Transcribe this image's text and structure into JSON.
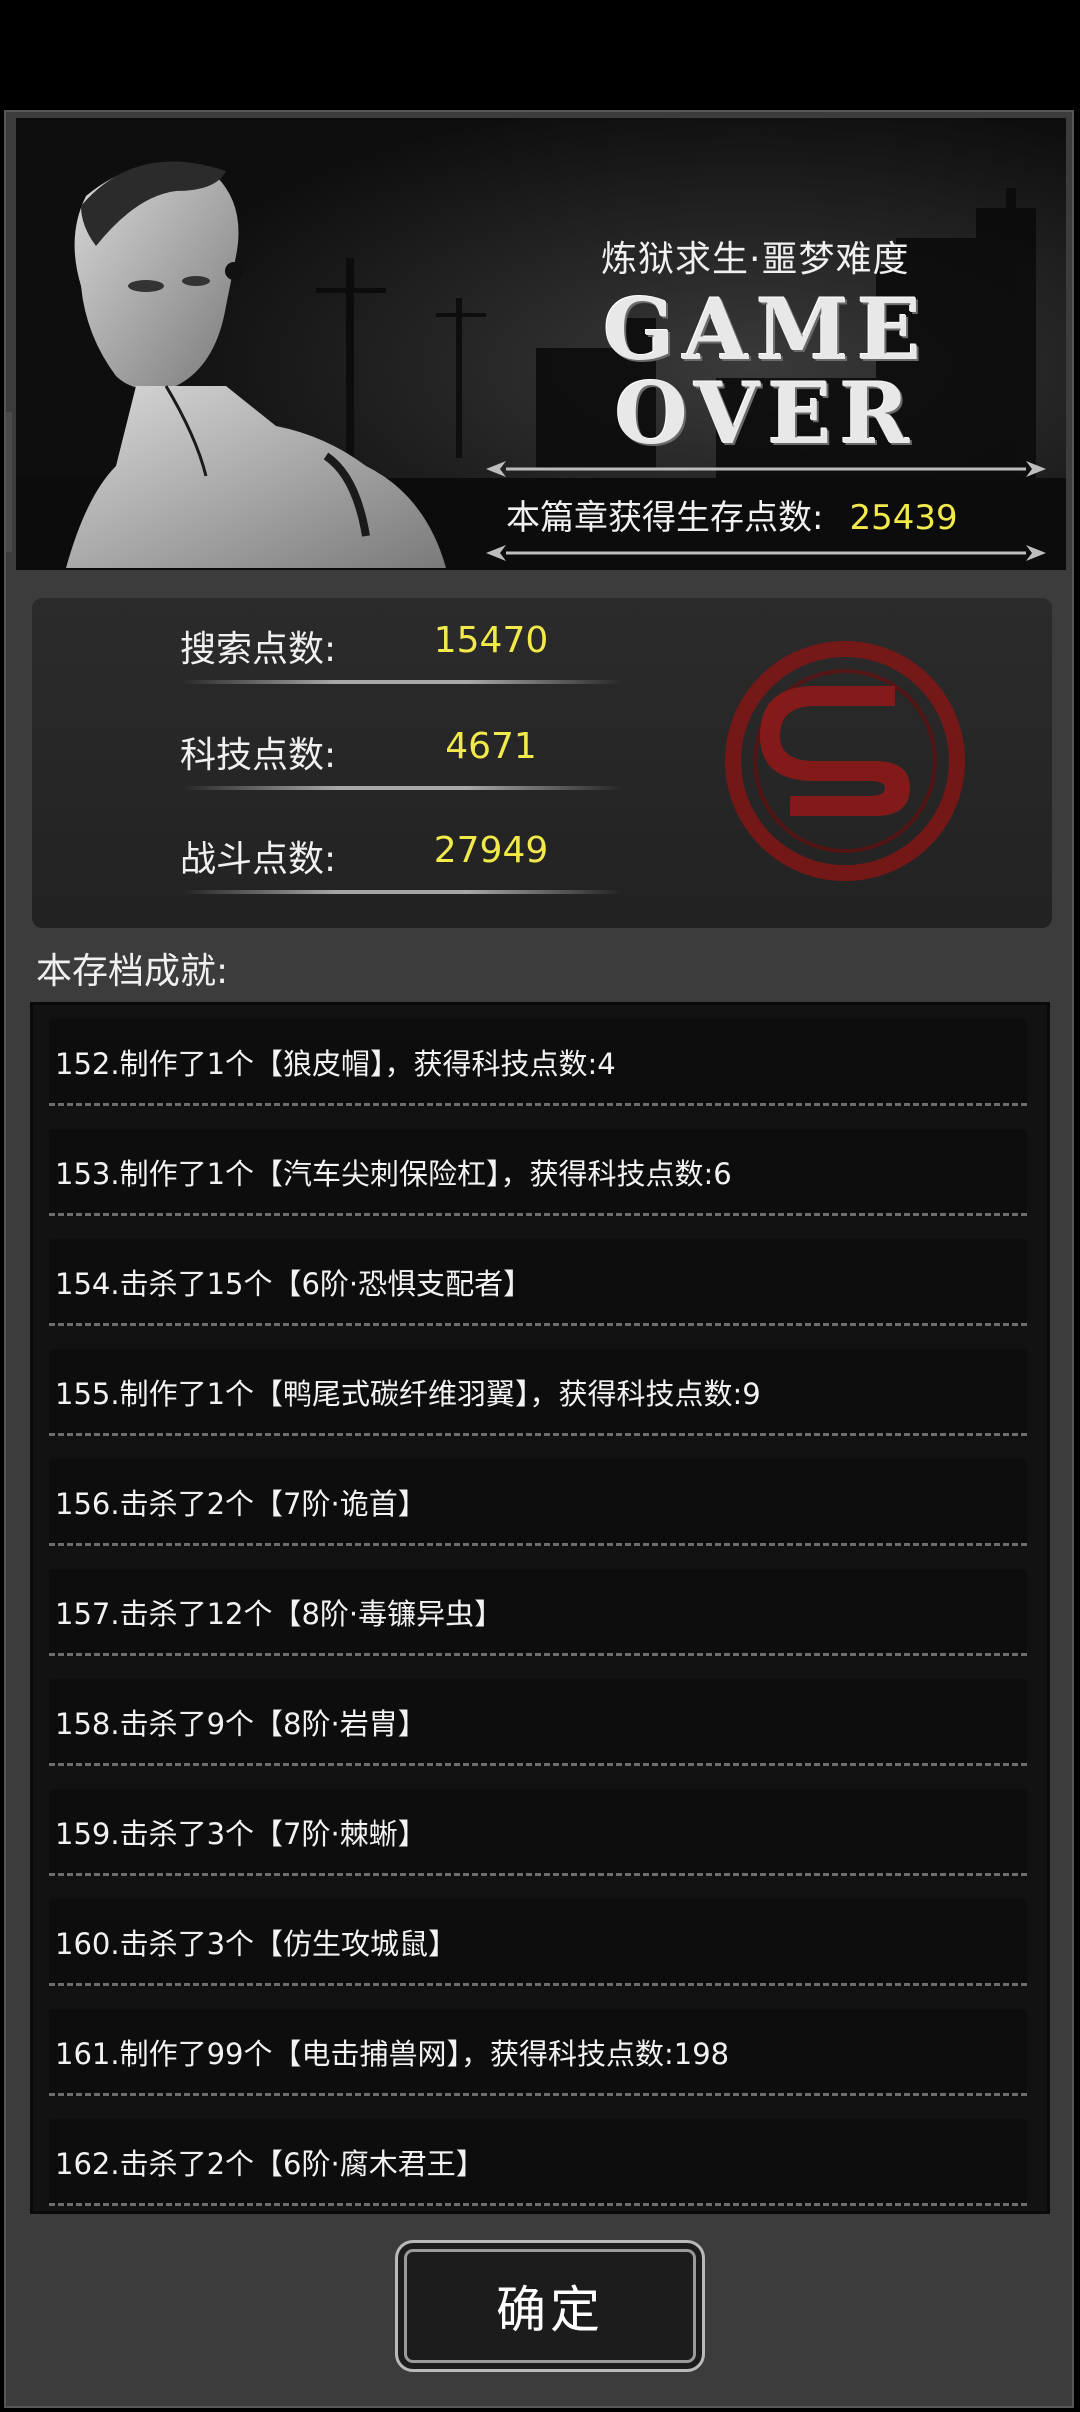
{
  "banner": {
    "subtitle": "炼狱求生·噩梦难度",
    "game_over_line1": "GAME",
    "game_over_line2": "OVER",
    "earned_label": "本篇章获得生存点数:",
    "earned_value": "25439"
  },
  "stats": [
    {
      "label": "搜索点数:",
      "value": "15470"
    },
    {
      "label": "科技点数:",
      "value": "4671"
    },
    {
      "label": "战斗点数:",
      "value": "27949"
    }
  ],
  "achievements_title": "本存档成就:",
  "achievements": [
    "152.制作了1个【狼皮帽】，获得科技点数:4",
    "153.制作了1个【汽车尖刺保险杠】，获得科技点数:6",
    "154.击杀了15个【6阶·恐惧支配者】",
    "155.制作了1个【鸭尾式碳纤维羽翼】，获得科技点数:9",
    "156.击杀了2个【7阶·诡首】",
    "157.击杀了12个【8阶·毒镰异虫】",
    "158.击杀了9个【8阶·岩胄】",
    "159.击杀了3个【7阶·棘蜥】",
    "160.击杀了3个【仿生攻城鼠】",
    "161.制作了99个【电击捕兽网】，获得科技点数:198",
    "162.击杀了2个【6阶·腐木君王】"
  ],
  "confirm_label": "确定",
  "colors": {
    "accent_value": "#f2ea4a",
    "emblem_red": "#8e1a1a"
  }
}
